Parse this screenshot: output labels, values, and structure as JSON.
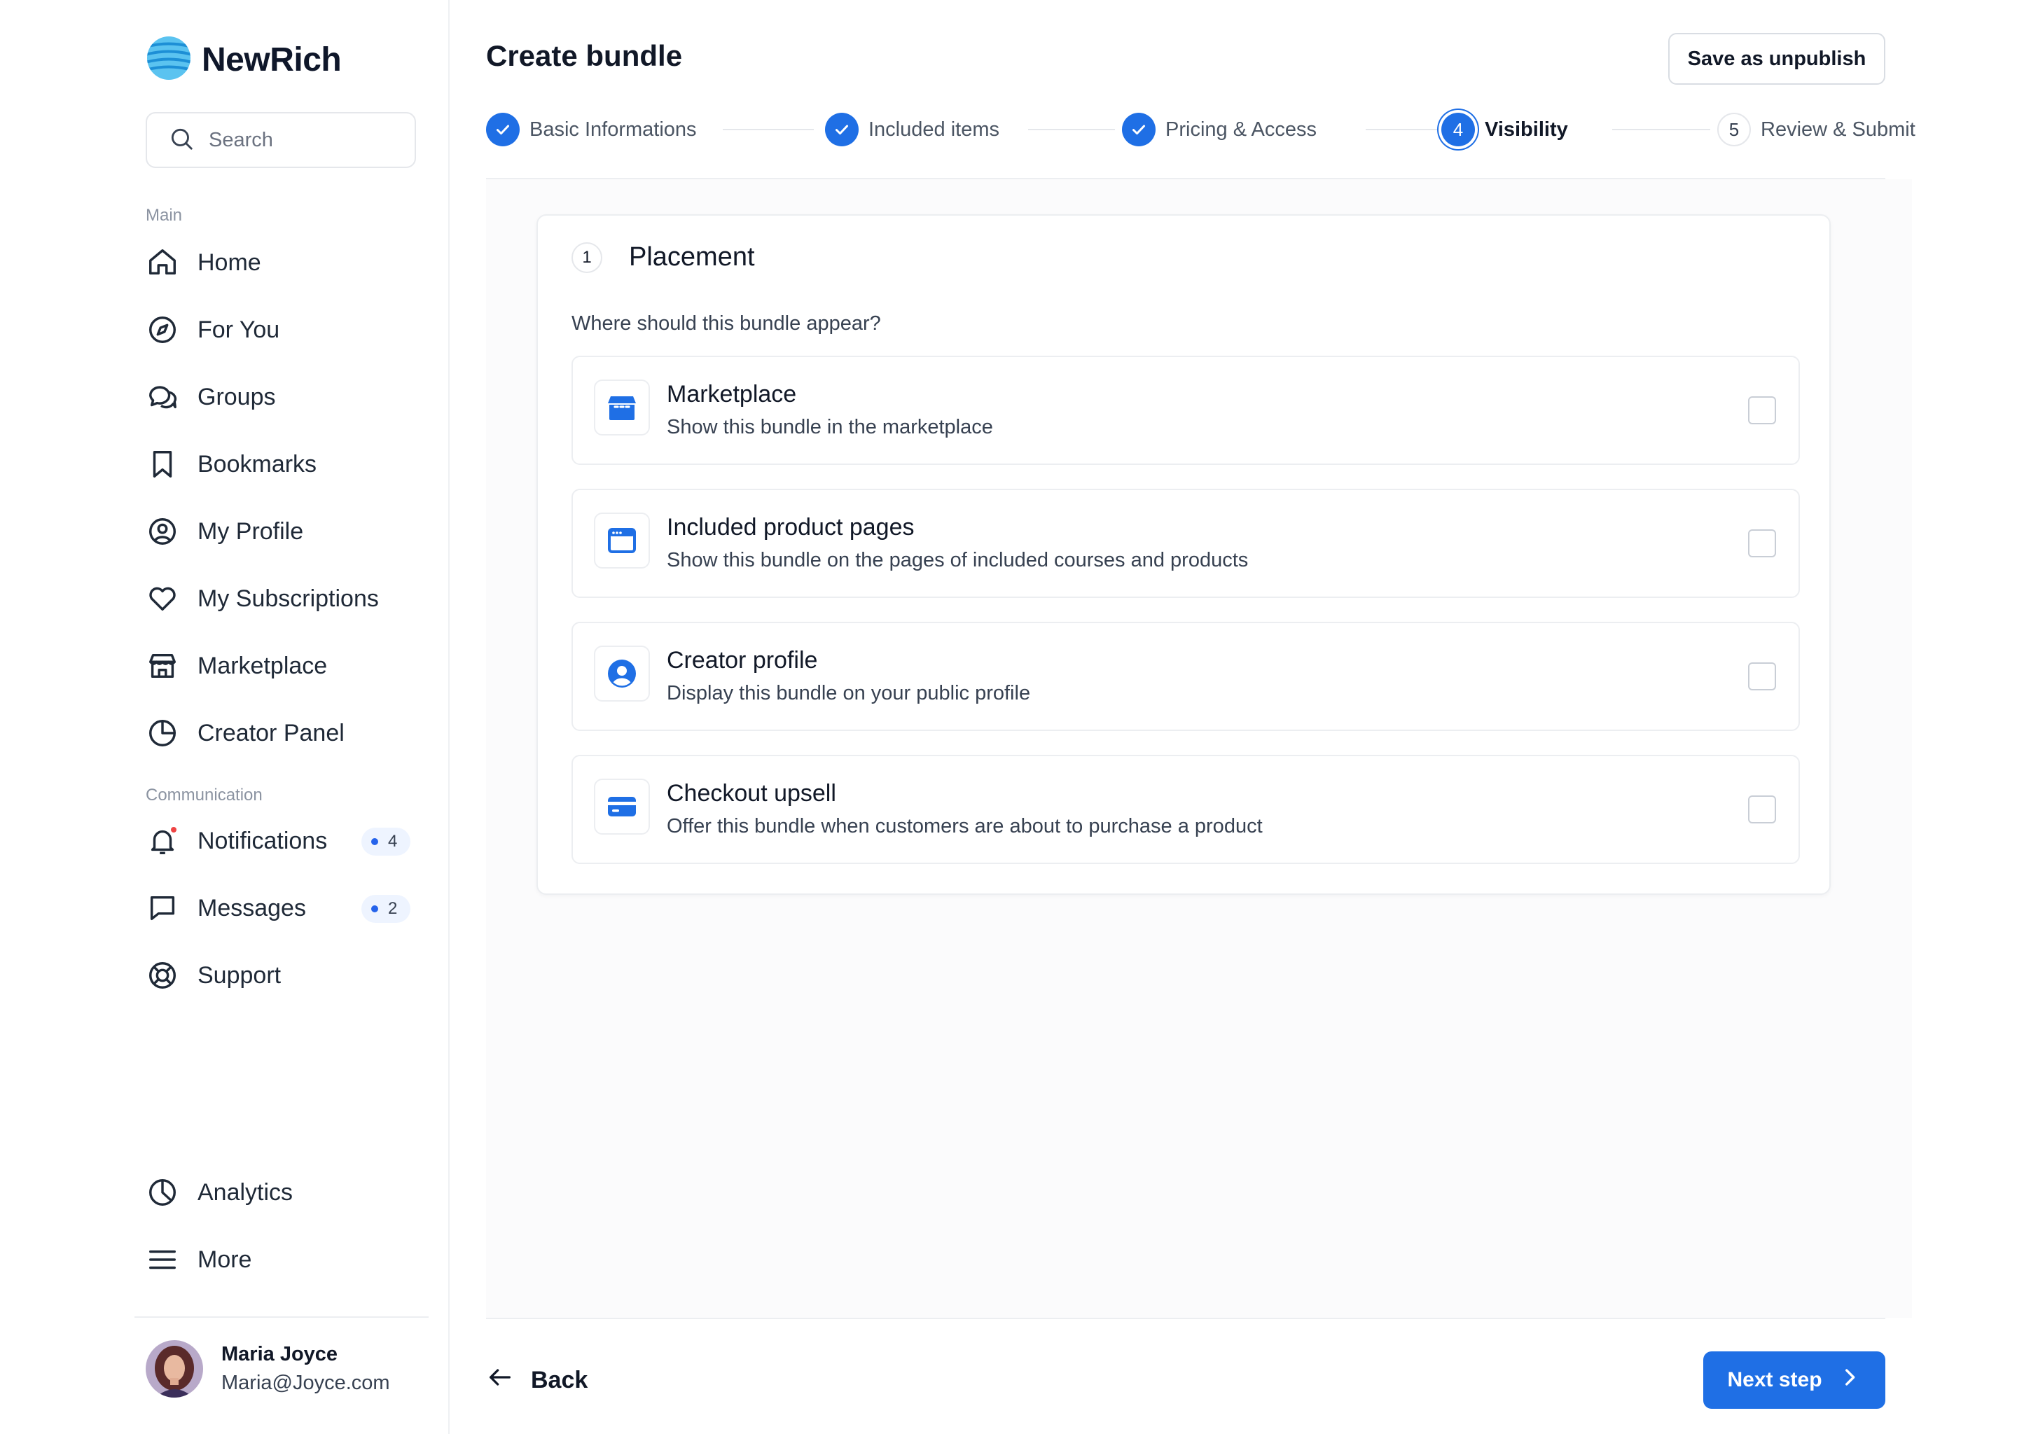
{
  "brand": {
    "name": "NewRich",
    "logo_icon": "globe-logo-icon"
  },
  "search": {
    "placeholder": "Search",
    "icon": "search-icon"
  },
  "sidebar": {
    "main_label": "Main",
    "main_items": [
      {
        "label": "Home",
        "icon": "home-icon"
      },
      {
        "label": "For You",
        "icon": "compass-icon"
      },
      {
        "label": "Groups",
        "icon": "chat-bubbles-icon"
      },
      {
        "label": "Bookmarks",
        "icon": "bookmark-icon"
      },
      {
        "label": "My Profile",
        "icon": "user-circle-icon"
      },
      {
        "label": "My Subscriptions",
        "icon": "heart-icon"
      },
      {
        "label": "Marketplace",
        "icon": "store-icon"
      },
      {
        "label": "Creator Panel",
        "icon": "pie-chart-icon"
      }
    ],
    "communication_label": "Communication",
    "communication_items": [
      {
        "label": "Notifications",
        "icon": "bell-icon",
        "count": "4"
      },
      {
        "label": "Messages",
        "icon": "message-icon",
        "count": "2"
      },
      {
        "label": "Support",
        "icon": "lifebuoy-icon"
      }
    ],
    "bottom_items": [
      {
        "label": "Analytics",
        "icon": "analytics-icon"
      },
      {
        "label": "More",
        "icon": "menu-icon"
      }
    ]
  },
  "user": {
    "name": "Maria Joyce",
    "email": "Maria@Joyce.com"
  },
  "header": {
    "title": "Create bundle",
    "save_label": "Save as unpublish"
  },
  "steps": [
    {
      "label": "Basic Informations",
      "state": "done"
    },
    {
      "label": "Included items",
      "state": "done"
    },
    {
      "label": "Pricing & Access",
      "state": "done"
    },
    {
      "label": "Visibility",
      "state": "active",
      "number": "4"
    },
    {
      "label": "Review & Submit",
      "state": "todo",
      "number": "5"
    }
  ],
  "placement": {
    "number": "1",
    "title": "Placement",
    "question": "Where should this bundle appear?",
    "options": [
      {
        "title": "Marketplace",
        "description": "Show this bundle in the marketplace",
        "icon": "store-icon",
        "checked": false
      },
      {
        "title": "Included product pages",
        "description": "Show this bundle on the pages of included courses and products",
        "icon": "browser-window-icon",
        "checked": false
      },
      {
        "title": "Creator profile",
        "description": "Display this bundle on your public profile",
        "icon": "user-circle-icon",
        "checked": false
      },
      {
        "title": "Checkout upsell",
        "description": "Offer this bundle when customers are about to purchase a product",
        "icon": "credit-card-icon",
        "checked": false
      }
    ]
  },
  "footer": {
    "back_label": "Back",
    "next_label": "Next step"
  },
  "colors": {
    "accent": "#1f6fe5",
    "notification_dot": "#ef4444"
  }
}
